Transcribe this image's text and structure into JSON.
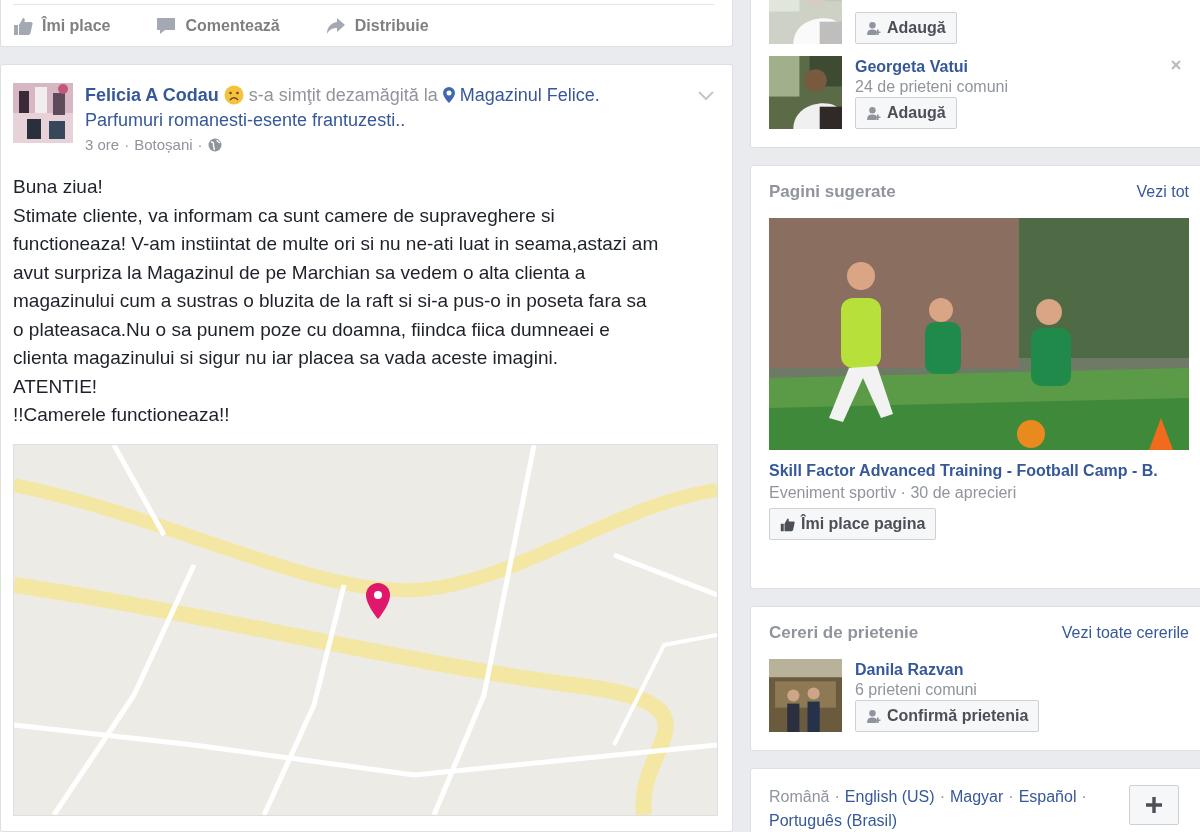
{
  "top_post_actions": [
    {
      "kind": "like",
      "label": "Îmi place"
    },
    {
      "kind": "comment",
      "label": "Comentează"
    },
    {
      "kind": "share",
      "label": "Distribuie"
    }
  ],
  "post": {
    "author": "Felicia A Codau",
    "feeling": "s-a simţit dezamăgită la",
    "place": "Magazinul Felice.",
    "place_detail": "Parfumuri romanesti-esente frantuzesti..",
    "meta": [
      {
        "text": "3 ore",
        "separator": "·"
      },
      {
        "text": "Botoșani",
        "separator": "·"
      }
    ],
    "lines": [
      "Buna ziua!",
      "Stimate cliente, va informam ca sunt camere de supraveghere si",
      "functioneaza! V-am instiintat de multe ori si nu ne-ati luat in seama,astazi am",
      "avut surpriza la Magazinul de pe Marchian sa vedem o alta clienta a",
      "magazinului cum a sustras o bluzita de la raft si si-a pus-o in poseta fara sa",
      "o plateasaca.Nu o sa punem poze cu doamna, fiindca fiica dumneaei e",
      "clienta magazinului si sigur nu iar placea sa vada aceste imagini.",
      "ATENTIE!",
      "!!Camerele functioneaza!!"
    ]
  },
  "people_you_may_know": [
    {
      "button": "Adaugă"
    },
    {
      "name": "Georgeta Vatui",
      "mutual": "24 de prieteni comuni",
      "button": "Adaugă"
    }
  ],
  "suggested_pages": {
    "title": "Pagini sugerate",
    "see_all": "Vezi tot",
    "page": {
      "name": "Skill Factor Advanced Training - Football Camp - B.",
      "meta": "Eveniment sportiv · 30 de aprecieri",
      "button": "Îmi place pagina"
    }
  },
  "friend_requests": {
    "title": "Cereri de prietenie",
    "see_all": "Vezi toate cererile",
    "items": [
      {
        "name": "Danila Razvan",
        "mutual": "6 prieteni comuni",
        "button": "Confirmă prietenia"
      }
    ]
  },
  "languages": [
    {
      "label": "Română",
      "selected": true,
      "separator": "·"
    },
    {
      "label": "English (US)",
      "selected": false,
      "separator": "·"
    },
    {
      "label": "Magyar",
      "selected": false,
      "separator": "·"
    },
    {
      "label": "Español",
      "selected": false,
      "separator": "·"
    },
    {
      "label": "Português (Brasil)",
      "selected": false
    }
  ]
}
